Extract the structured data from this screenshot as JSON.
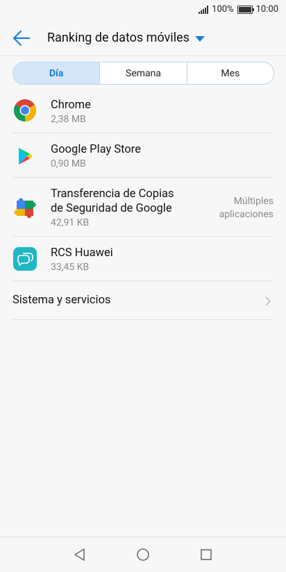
{
  "status": {
    "battery": "100%",
    "time": "10:00"
  },
  "header": {
    "title": "Ranking de datos móviles"
  },
  "tabs": [
    {
      "label": "Día",
      "active": true
    },
    {
      "label": "Semana",
      "active": false
    },
    {
      "label": "Mes",
      "active": false
    }
  ],
  "apps": [
    {
      "name": "Chrome",
      "size": "2,38 MB",
      "icon": "chrome-icon"
    },
    {
      "name": "Google Play Store",
      "size": "0,90 MB",
      "icon": "play-store-icon"
    },
    {
      "name_line1": "Transferencia de Copias",
      "name_line2": "de Seguridad de Google",
      "size": "42,91 KB",
      "note_line1": "Múltiples",
      "note_line2": "aplicaciones",
      "icon": "google-services-icon"
    },
    {
      "name": "RCS Huawei",
      "size": "33,45 KB",
      "icon": "rcs-icon"
    }
  ],
  "system": {
    "label": "Sistema y servicios"
  },
  "colors": {
    "accent": "#1a7fd4",
    "tab_active_bg": "#d5e6f8"
  }
}
